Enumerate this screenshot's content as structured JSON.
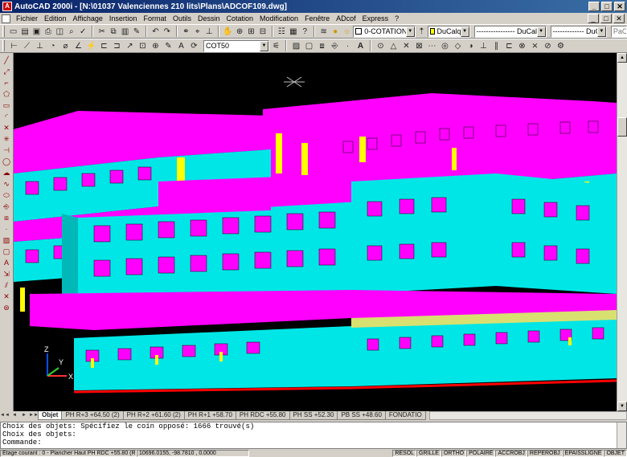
{
  "window": {
    "title": "AutoCAD 2000i - [N:\\01037 Valenciennes 210 lits\\Plans\\ADCOF109.dwg]",
    "app_icon": "A",
    "controls": [
      "_",
      "□",
      "✕"
    ]
  },
  "menu": {
    "items": [
      "Fichier",
      "Edition",
      "Affichage",
      "Insertion",
      "Format",
      "Outils",
      "Dessin",
      "Cotation",
      "Modification",
      "Fenêtre",
      "ADcof",
      "Express",
      "?"
    ],
    "right_controls": [
      "_",
      "□",
      "✕"
    ]
  },
  "toolbar": {
    "layer_value": "0-COTATION",
    "color_value": "DuCalque",
    "linetype_value": "---------------- DuCalque",
    "lineweight_value": "------------- DuCalque",
    "plotstyle_value": "PaCo",
    "dimstyle_value": "COT50"
  },
  "tabs": {
    "nav": [
      "◄◄",
      "◄",
      "►",
      "►►"
    ],
    "items": [
      "Objet",
      "PH R+3 +64.50 (2)",
      "PH R+2 +61.60 (2)",
      "PH R+1 +58.70",
      "PH RDC +55.80",
      "PH SS +52.30",
      "PB SS +48.60",
      "FONDATIO"
    ],
    "active_index": 0
  },
  "command": {
    "lines": [
      "Choix des objets: Spécifiez le coin opposé: 1666 trouvé(s)",
      "Choix des objets:",
      "Commande:"
    ]
  },
  "status": {
    "layer": "Etage courant : 0 - Plancher Haut PH RDC +55.80  (R+1)",
    "coords": "10696.0155, -98.7810  , 0.0000",
    "toggles": [
      "RESOL",
      "GRILLE",
      "ORTHO",
      "POLAIRE",
      "ACCROBJ",
      "REPEROBJ",
      "EPAISSLIGNE",
      "OBJET"
    ]
  },
  "ucs": {
    "x_label": "X",
    "y_label": "Y",
    "z_label": "Z"
  },
  "colors": {
    "magenta": "#ff00ff",
    "cyan": "#00e6e6",
    "yellow": "#ffff00",
    "red": "#ff0000",
    "navy": "#0a246a"
  }
}
